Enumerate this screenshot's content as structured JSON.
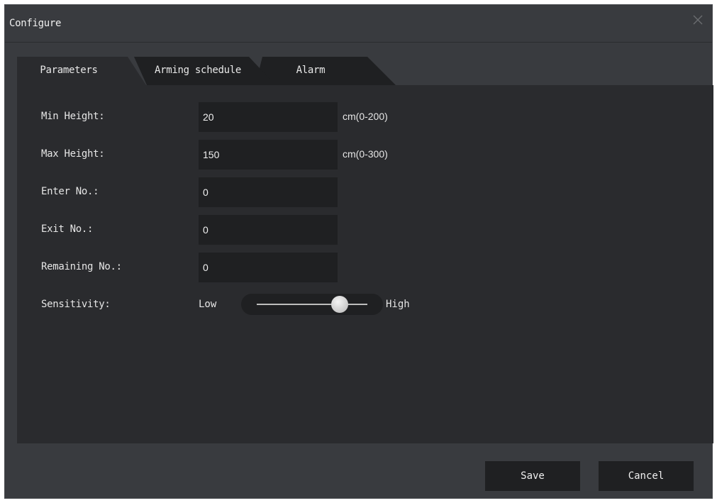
{
  "dialog": {
    "title": "Configure"
  },
  "tabs": [
    {
      "label": "Parameters",
      "active": true
    },
    {
      "label": "Arming schedule",
      "active": false
    },
    {
      "label": "Alarm",
      "active": false
    }
  ],
  "fields": {
    "min_height": {
      "label": "Min Height:",
      "value": "20",
      "unit": "cm(0-200)"
    },
    "max_height": {
      "label": "Max Height:",
      "value": "150",
      "unit": "cm(0-300)"
    },
    "enter_no": {
      "label": "Enter No.:",
      "value": "0"
    },
    "exit_no": {
      "label": "Exit No.:",
      "value": "0"
    },
    "remaining_no": {
      "label": "Remaining No.:",
      "value": "0"
    }
  },
  "sensitivity": {
    "label": "Sensitivity:",
    "low_label": "Low",
    "high_label": "High",
    "level": 0.75
  },
  "buttons": {
    "save": "Save",
    "cancel": "Cancel"
  },
  "icons": {
    "close": "close-icon"
  },
  "colors": {
    "dialog_bg": "#393b3f",
    "panel_bg": "#2a2b2e",
    "field_bg": "#1f2022",
    "active_tab": "#2a2b2e",
    "inactive_tab": "#1f2022"
  }
}
